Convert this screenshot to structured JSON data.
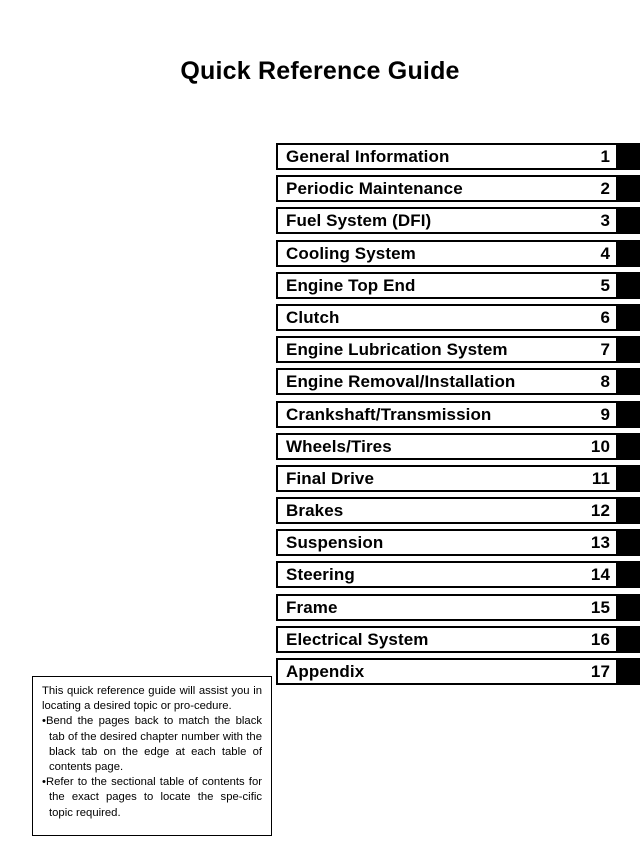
{
  "page": {
    "title": "Quick Reference Guide"
  },
  "toc": {
    "rows": [
      {
        "title": "General Information",
        "number": "1"
      },
      {
        "title": "Periodic Maintenance",
        "number": "2"
      },
      {
        "title": "Fuel System (DFI)",
        "number": "3"
      },
      {
        "title": "Cooling System",
        "number": "4"
      },
      {
        "title": "Engine Top End",
        "number": "5"
      },
      {
        "title": "Clutch",
        "number": "6"
      },
      {
        "title": "Engine Lubrication System",
        "number": "7"
      },
      {
        "title": "Engine Removal/Installation",
        "number": "8"
      },
      {
        "title": "Crankshaft/Transmission",
        "number": "9"
      },
      {
        "title": "Wheels/Tires",
        "number": "10"
      },
      {
        "title": "Final Drive",
        "number": "11"
      },
      {
        "title": "Brakes",
        "number": "12"
      },
      {
        "title": "Suspension",
        "number": "13"
      },
      {
        "title": "Steering",
        "number": "14"
      },
      {
        "title": "Frame",
        "number": "15"
      },
      {
        "title": "Electrical System",
        "number": "16"
      },
      {
        "title": "Appendix",
        "number": "17"
      }
    ]
  },
  "note": {
    "intro": "This quick reference guide will assist you in locating a desired topic or pro-cedure.",
    "bullets": [
      "•Bend the pages back to match the black tab of the desired chapter number with the black tab on the edge at each table of contents page.",
      "•Refer to the sectional table of contents for the exact pages to locate the spe-cific topic required."
    ]
  },
  "colors": {
    "page_background": "#ffffff",
    "ink": "#000000",
    "tab_black": "#000000"
  }
}
